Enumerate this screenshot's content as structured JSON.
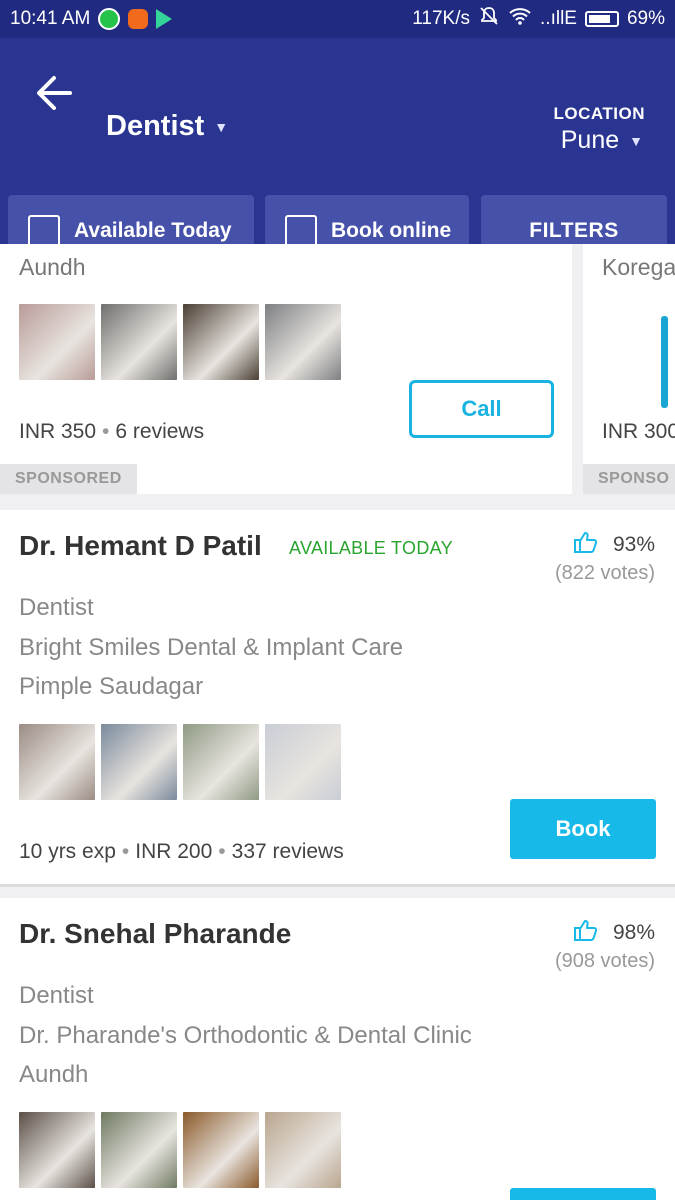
{
  "status_bar": {
    "time": "10:41 AM",
    "net_speed": "117K/s",
    "signal": "..ıllE",
    "battery": "69%"
  },
  "header": {
    "title": "Dentist",
    "location_label": "LOCATION",
    "location_value": "Pune"
  },
  "filters": {
    "available_today": "Available Today",
    "book_online": "Book online",
    "filters_button": "FILTERS"
  },
  "sponsored": [
    {
      "area": "Aundh",
      "fee": "INR 350",
      "reviews": "6 reviews",
      "action": "Call",
      "tag": "SPONSORED",
      "photo_colors": [
        "#b99b98",
        "#6f6f6d",
        "#4a4034",
        "#7d7f83"
      ]
    },
    {
      "area": "Korega",
      "fee": "INR 300",
      "tag": "SPONSO"
    }
  ],
  "doctors": [
    {
      "name": "Dr. Hemant D Patil",
      "availability": "AVAILABLE TODAY",
      "rating": "93%",
      "votes": "(822 votes)",
      "specialty": "Dentist",
      "clinic": "Bright Smiles Dental & Implant Care",
      "area": "Pimple Saudagar",
      "experience": "10 yrs exp",
      "fee": "INR 200",
      "reviews": "337 reviews",
      "action": "Book",
      "photo_colors": [
        "#9a8c84",
        "#7b8a9c",
        "#8f9a84",
        "#c9cdd6"
      ]
    },
    {
      "name": "Dr. Snehal Pharande",
      "rating": "98%",
      "votes": "(908 votes)",
      "specialty": "Dentist",
      "clinic": "Dr. Pharande's Orthodontic & Dental Clinic",
      "area": "Aundh",
      "photo_colors": [
        "#5b5048",
        "#6f7a62",
        "#8b5a2b",
        "#b9a58e"
      ]
    }
  ],
  "colors": {
    "appbar": "#2a3591",
    "accent": "#17b9e8",
    "available": "#2aa52f"
  }
}
